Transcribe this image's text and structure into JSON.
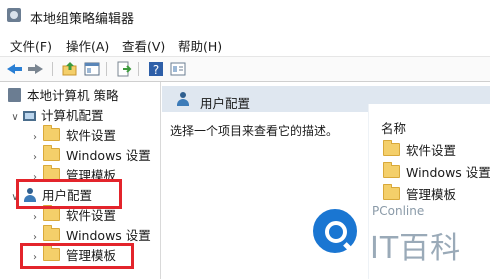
{
  "window": {
    "title": "本地组策略编辑器"
  },
  "menu": [
    "文件(F)",
    "操作(A)",
    "查看(V)",
    "帮助(H)"
  ],
  "toolbar": {
    "buttons": [
      "back-arrow-icon",
      "forward-arrow-icon",
      "up-folder-icon",
      "show-hide-tree-icon",
      "export-icon",
      "help-icon",
      "properties-icon"
    ]
  },
  "tree": {
    "root": "本地计算机 策略",
    "computer_config": "计算机配置",
    "computer_children": [
      "软件设置",
      "Windows 设置",
      "管理模板"
    ],
    "user_config": "用户配置",
    "user_children": [
      "软件设置",
      "Windows 设置",
      "管理模板"
    ]
  },
  "right_pane": {
    "header": "用户配置",
    "description": "选择一个项目来查看它的描述。",
    "column_name": "名称",
    "items": [
      "软件设置",
      "Windows 设置",
      "管理模板"
    ]
  },
  "watermark": {
    "site": "PConline",
    "brand": "IT百科"
  },
  "colors": {
    "highlight": "#e3242b",
    "header_bg": "#dfe7f0",
    "folder": "#f4cf6a",
    "logo_blue": "#1a76d2"
  }
}
